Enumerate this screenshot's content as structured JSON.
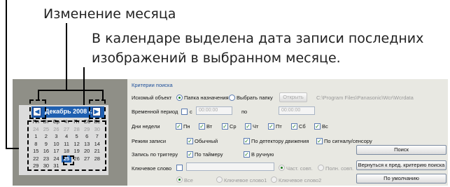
{
  "annotations": {
    "month_change": "Изменение месяца",
    "highlight_line1": "В календаре выделена дата записи последних",
    "highlight_line2": "изображений в выбранном месяце."
  },
  "calendar": {
    "prev": "◀",
    "next": "▶",
    "title": "Декабрь 2008 г.",
    "weekdays": [
      "Пн",
      "Вт",
      "Ср",
      "Чт",
      "Пт",
      "Сб",
      "Вс"
    ],
    "rows": [
      [
        "24",
        "25",
        "26",
        "27",
        "28",
        "29",
        "30"
      ],
      [
        "1",
        "2",
        "3",
        "4",
        "5",
        "6",
        "7"
      ],
      [
        "8",
        "9",
        "10",
        "11",
        "12",
        "13",
        "14"
      ],
      [
        "15",
        "16",
        "17",
        "18",
        "19",
        "20",
        "21"
      ],
      [
        "22",
        "23",
        "24",
        "25",
        "26",
        "27",
        "28"
      ],
      [
        "29",
        "30",
        "31",
        "",
        "",
        "",
        ""
      ]
    ],
    "selected": "25"
  },
  "search": {
    "group_title": "Критерии поиска",
    "object_label": "Искомый объект",
    "dest_folder": "Папка назначения",
    "choose_folder": "Выбрать папку",
    "open_btn": "Открыть",
    "path": "C:\\Program Files\\Panasonic\\Wcr\\Wcrdata",
    "period_label": "Временной период",
    "from_label": "с",
    "to_label": "по",
    "time_from": "00:00:00",
    "time_to": "00:00:00",
    "weekdays_label": "Дни недели",
    "days": [
      "Пн",
      "Вт",
      "Ср",
      "Чт",
      "Пт",
      "Сб",
      "Вс"
    ],
    "mode_label": "Режим записи",
    "mode_normal": "Обычный",
    "mode_motion": "По детектору движения",
    "mode_signal": "По сигналу/сенсору",
    "trigger_label": "Запись по триггеру",
    "trigger_timer": "По таймеру",
    "trigger_manual": "В ручную",
    "keyword_label": "Ключевое слово",
    "partial": "Част. совп.",
    "full": "Полн. совп.",
    "all": "Все",
    "kw1": "Ключевое слово1",
    "kw2": "Ключевое слово2",
    "search_btn": "Поиск",
    "back_btn": "Вернуться к пред. критерию поиска",
    "default_btn": "По умолчанию"
  }
}
